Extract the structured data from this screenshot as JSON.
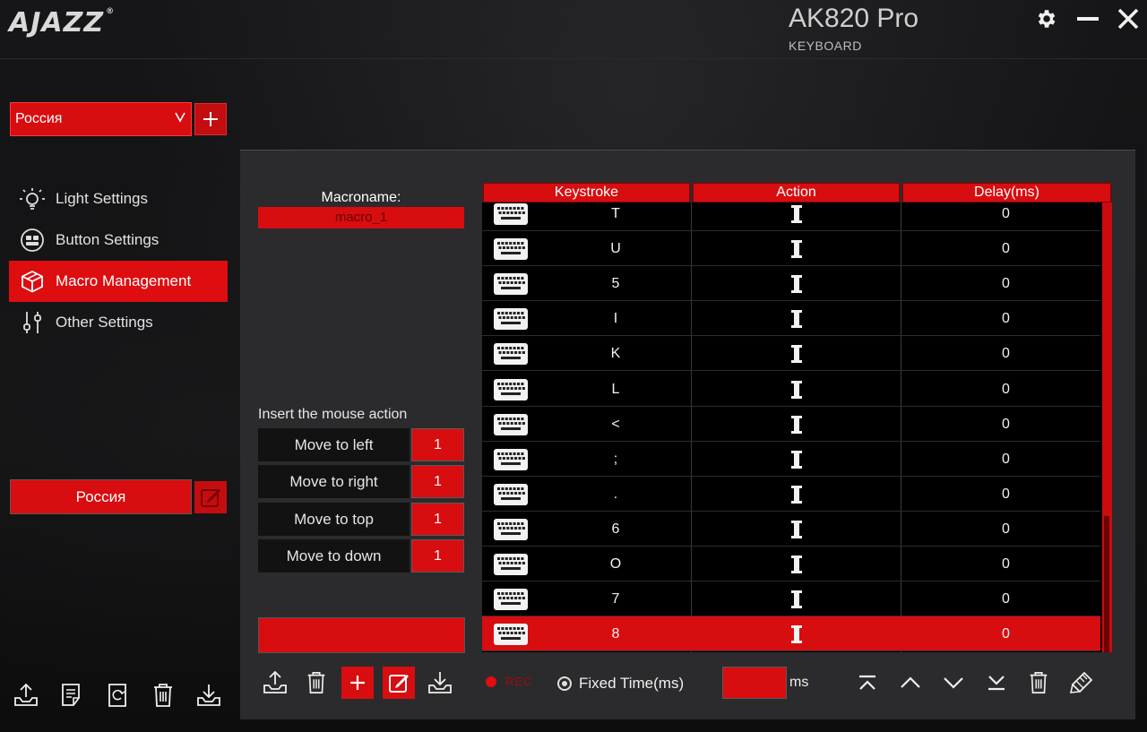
{
  "header": {
    "logo": "AJAZZ",
    "logo_mark": "®",
    "model": "AK820 Pro",
    "device_type": "KEYBOARD"
  },
  "profile": {
    "selected": "Россия",
    "current": "Россия"
  },
  "nav": [
    {
      "label": "Light Settings",
      "icon": "bulb-icon",
      "active": false
    },
    {
      "label": "Button Settings",
      "icon": "buttons-icon",
      "active": false
    },
    {
      "label": "Macro Management",
      "icon": "cube-icon",
      "active": true
    },
    {
      "label": "Other Settings",
      "icon": "sliders-icon",
      "active": false
    }
  ],
  "macro": {
    "name_label": "Macroname:",
    "name_value": "macro_1",
    "insert_label": "Insert the mouse action",
    "moves": [
      {
        "label": "Move to left",
        "value": "1"
      },
      {
        "label": "Move to right",
        "value": "1"
      },
      {
        "label": "Move to top",
        "value": "1"
      },
      {
        "label": "Move to down",
        "value": "1"
      }
    ]
  },
  "table": {
    "headers": {
      "keystroke": "Keystroke",
      "action": "Action",
      "delay": "Delay(ms)"
    },
    "rows": [
      {
        "key": "T",
        "delay": "0"
      },
      {
        "key": "U",
        "delay": "0"
      },
      {
        "key": "5",
        "delay": "0"
      },
      {
        "key": "I",
        "delay": "0"
      },
      {
        "key": "K",
        "delay": "0"
      },
      {
        "key": "L",
        "delay": "0"
      },
      {
        "key": "<",
        "delay": "0"
      },
      {
        "key": ";",
        "delay": "0"
      },
      {
        "key": ".",
        "delay": "0"
      },
      {
        "key": "6",
        "delay": "0"
      },
      {
        "key": "O",
        "delay": "0"
      },
      {
        "key": "7",
        "delay": "0"
      },
      {
        "key": "8",
        "delay": "0"
      }
    ],
    "selected_row": 12
  },
  "controls": {
    "rec_label": "REC",
    "fixed_time_label": "Fixed Time(ms)",
    "fixed_time_value": "",
    "ms_unit": "ms"
  },
  "colors": {
    "accent": "#d80d10",
    "panel": "#2b2b2d",
    "background": "#0e0e0f"
  }
}
